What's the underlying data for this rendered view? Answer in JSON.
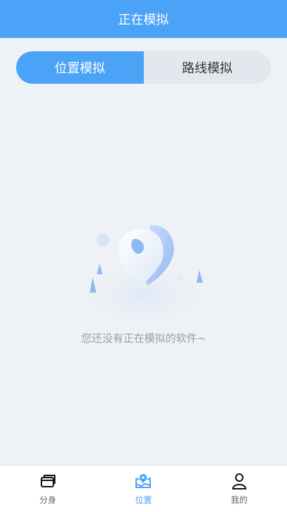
{
  "header": {
    "title": "正在模拟"
  },
  "tabs": [
    {
      "label": "位置模拟",
      "active": true
    },
    {
      "label": "路线模拟",
      "active": false
    }
  ],
  "empty_state": {
    "message": "您还没有正在模拟的软件~"
  },
  "bottom_nav": [
    {
      "label": "分身",
      "icon": "cards-icon"
    },
    {
      "label": "位置",
      "icon": "location-map-icon",
      "active": true
    },
    {
      "label": "我的",
      "icon": "user-icon"
    }
  ],
  "colors": {
    "accent": "#4aa3f7",
    "background": "#eef1f5"
  }
}
